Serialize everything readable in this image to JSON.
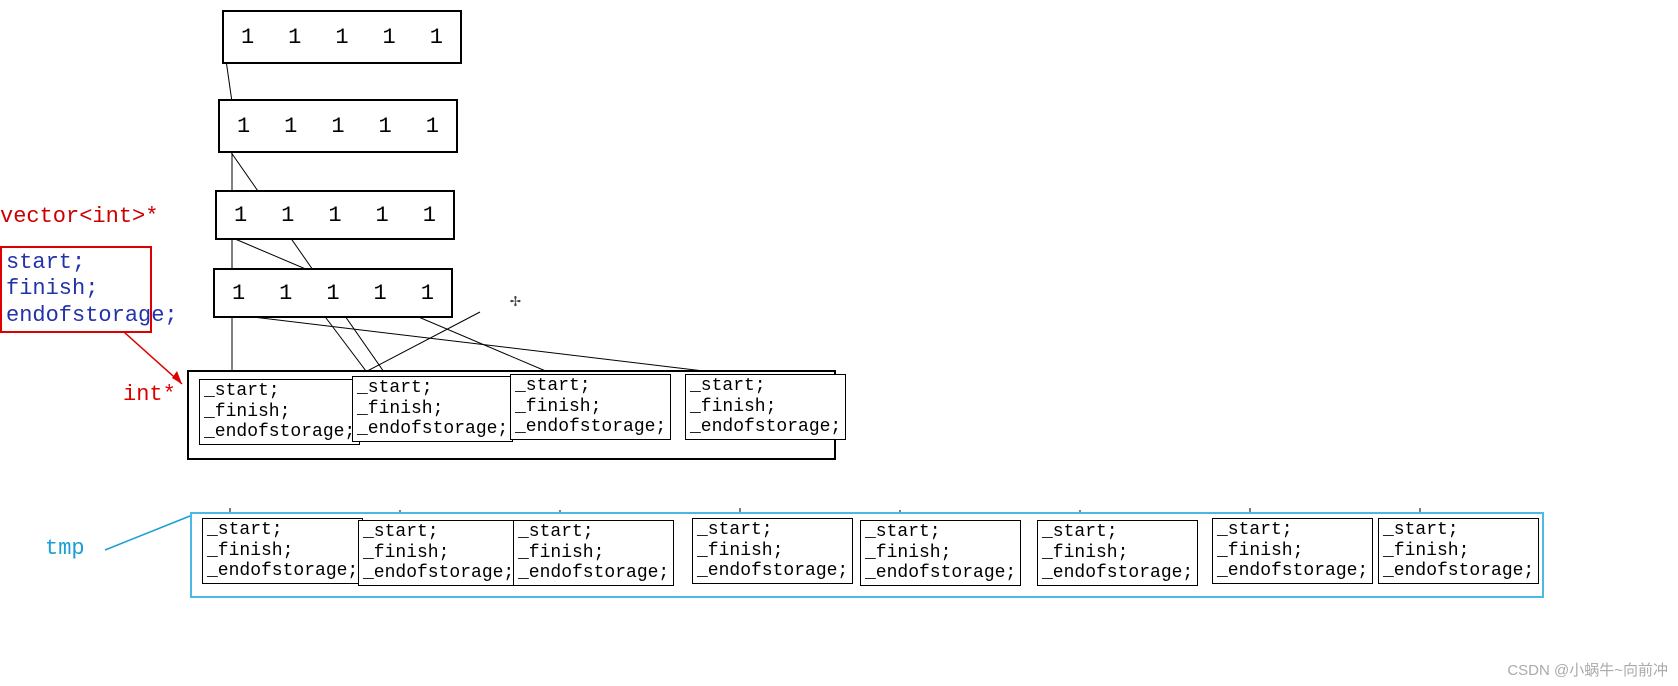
{
  "arrays": {
    "row0": [
      "1",
      "1",
      "1",
      "1",
      "1"
    ],
    "row1": [
      "1",
      "1",
      "1",
      "1",
      "1"
    ],
    "row2": [
      "1",
      "1",
      "1",
      "1",
      "1"
    ],
    "row3": [
      "1",
      "1",
      "1",
      "1",
      "1"
    ]
  },
  "labels": {
    "vector_ptr": "vector<int>*",
    "int_ptr": "int*",
    "tmp": "tmp"
  },
  "code_box": {
    "l1": "start;",
    "l2": "finish;",
    "l3": "endofstorage;"
  },
  "struct": {
    "l1": "_start;",
    "l2": "_finish;",
    "l3": "_endofstorage;"
  },
  "watermark": "CSDN @小蜗牛~向前冲",
  "cursor_glyph": "✢"
}
